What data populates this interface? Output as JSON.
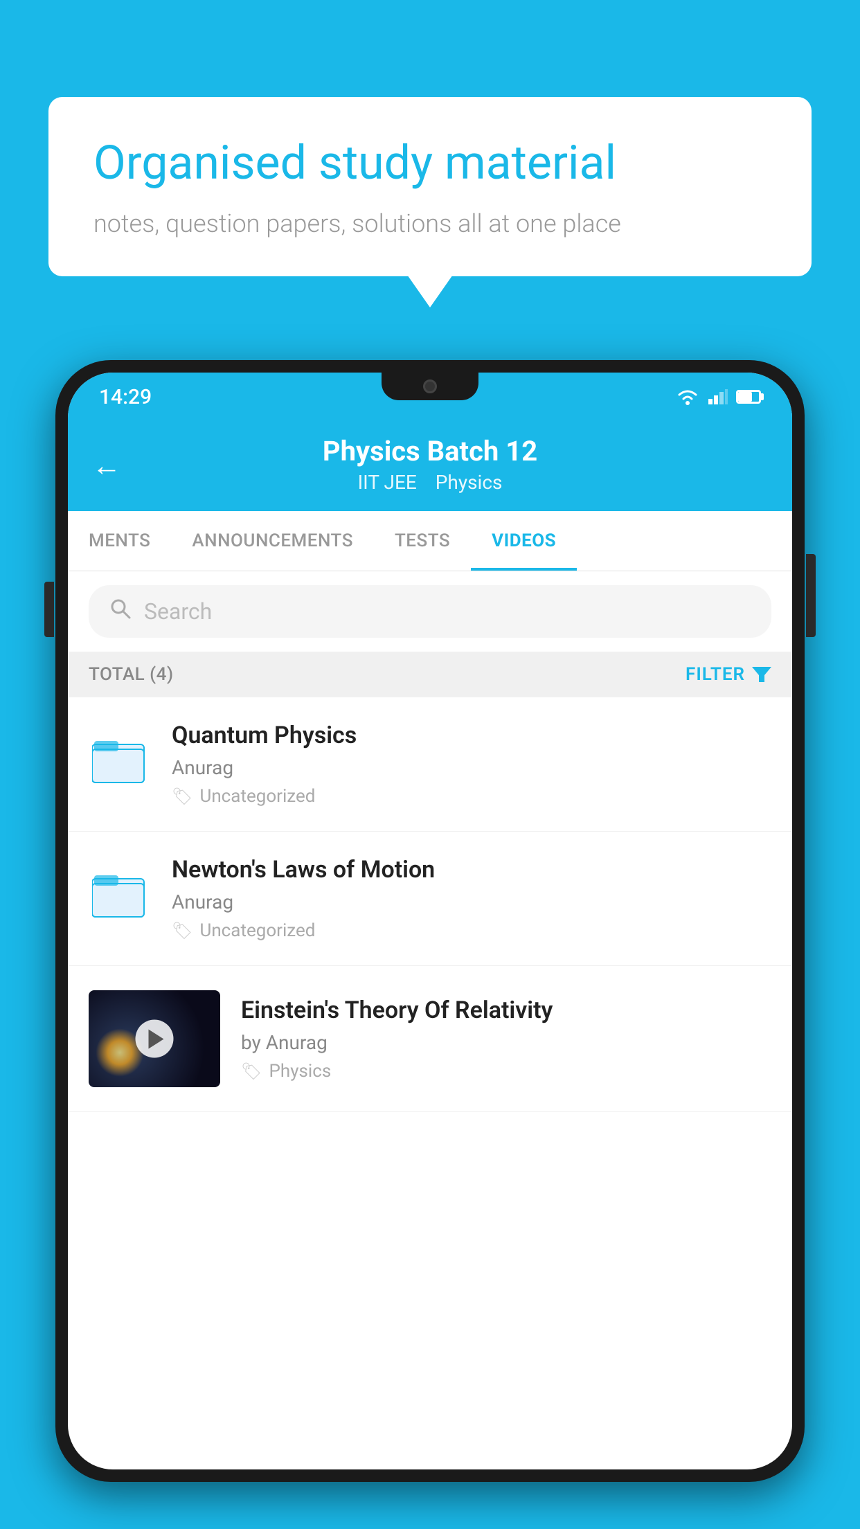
{
  "background_color": "#1ab8e8",
  "speech_bubble": {
    "title": "Organised study material",
    "subtitle": "notes, question papers, solutions all at one place"
  },
  "status_bar": {
    "time": "14:29"
  },
  "app_header": {
    "title": "Physics Batch 12",
    "subtitle_part1": "IIT JEE",
    "subtitle_part2": "Physics",
    "back_label": "←"
  },
  "tabs": [
    {
      "label": "MENTS",
      "active": false
    },
    {
      "label": "ANNOUNCEMENTS",
      "active": false
    },
    {
      "label": "TESTS",
      "active": false
    },
    {
      "label": "VIDEOS",
      "active": true
    }
  ],
  "search": {
    "placeholder": "Search"
  },
  "filter_bar": {
    "total_label": "TOTAL (4)",
    "filter_label": "FILTER"
  },
  "videos": [
    {
      "id": 1,
      "title": "Quantum Physics",
      "author": "Anurag",
      "tag": "Uncategorized",
      "type": "folder",
      "has_thumbnail": false
    },
    {
      "id": 2,
      "title": "Newton's Laws of Motion",
      "author": "Anurag",
      "tag": "Uncategorized",
      "type": "folder",
      "has_thumbnail": false
    },
    {
      "id": 3,
      "title": "Einstein's Theory Of Relativity",
      "author": "by Anurag",
      "tag": "Physics",
      "type": "video",
      "has_thumbnail": true
    }
  ]
}
